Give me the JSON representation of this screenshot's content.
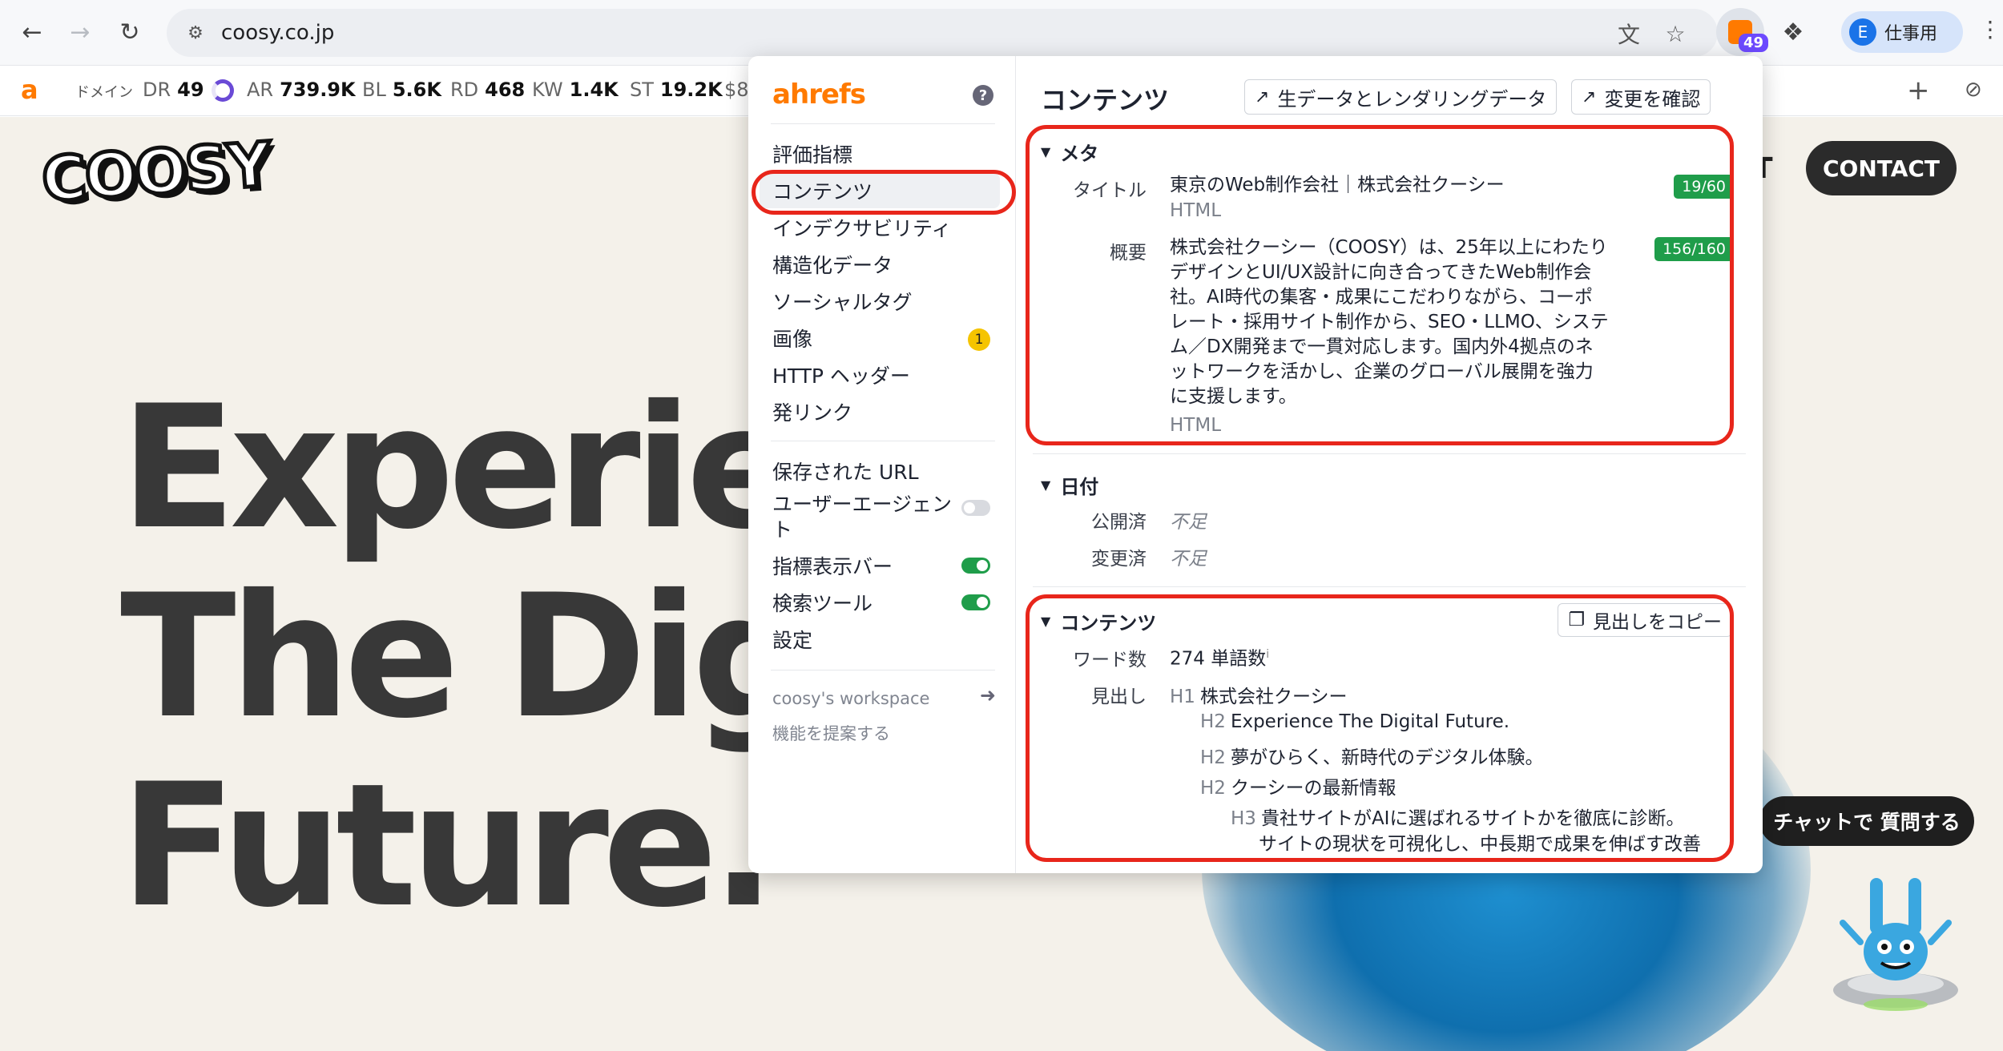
{
  "browser": {
    "url": "coosy.co.jp",
    "back_icon": "arrow-left-icon",
    "forward_icon": "arrow-right-icon",
    "reload_icon": "reload-icon",
    "ahrefs_ext_badge": "49",
    "profile_initial": "E",
    "profile_label": "仕事用"
  },
  "seo_bar": {
    "domain_label": "ドメイン",
    "metrics": [
      {
        "key": "DR",
        "value": "49"
      },
      {
        "key": "AR",
        "value": "739.9K"
      },
      {
        "key": "BL",
        "value": "5.6K"
      },
      {
        "key": "RD",
        "value": "468"
      },
      {
        "key": "KW",
        "value": "1.4K"
      },
      {
        "key": "ST",
        "value": "19.2K"
      },
      {
        "key": "$8",
        "value": ""
      }
    ]
  },
  "site": {
    "logo": "COOSY",
    "hero_lines": [
      "Experien",
      "The Digi",
      "Future."
    ],
    "contact": "CONTACT",
    "nav_fragment": "T",
    "chat": "チャットで 質問する"
  },
  "popup": {
    "logo": "ahrefs",
    "sidebar": {
      "items": [
        {
          "label": "評価指標"
        },
        {
          "label": "コンテンツ"
        },
        {
          "label": "インデクサビリティ"
        },
        {
          "label": "構造化データ"
        },
        {
          "label": "ソーシャルタグ"
        },
        {
          "label": "画像",
          "badge": "1"
        },
        {
          "label": "HTTP ヘッダー"
        },
        {
          "label": "発リンク"
        }
      ],
      "settings": [
        {
          "label": "保存された URL"
        },
        {
          "label": "ユーザーエージェン\nト",
          "label_line1": "ユーザーエージェン",
          "label_line2": "ト",
          "toggle": "off"
        },
        {
          "label": "指標表示バー",
          "toggle": "on"
        },
        {
          "label": "検索ツール",
          "toggle": "on"
        },
        {
          "label": "設定"
        }
      ],
      "workspace": "coosy's workspace",
      "suggest": "機能を提案する"
    },
    "main": {
      "title": "コンテンツ",
      "btn_raw": "生データとレンダリングデータ",
      "btn_changes": "変更を確認",
      "meta": {
        "section": "メタ",
        "title_label": "タイトル",
        "title_value": "東京のWeb制作会社｜株式会社クーシー",
        "title_source": "HTML",
        "title_count": "19/60",
        "desc_label": "概要",
        "desc_lines": [
          "株式会社クーシー（COOSY）は、25年以上にわたり",
          "デザインとUI/UX設計に向き合ってきたWeb制作会",
          "社。AI時代の集客・成果にこだわりながら、コーポ",
          "レート・採用サイト制作から、SEO・LLMO、システ",
          "ム／DX開発まで一貫対応します。国内外4拠点のネ",
          "ットワークを活かし、企業のグローバル展開を強力",
          "に支援します。"
        ],
        "desc_source": "HTML",
        "desc_count": "156/160"
      },
      "dates": {
        "section": "日付",
        "published_label": "公開済",
        "published_value": "不足",
        "modified_label": "変更済",
        "modified_value": "不足"
      },
      "content": {
        "section": "コンテンツ",
        "copy_btn": "見出しをコピー",
        "word_label": "ワード数",
        "word_value": "274 単語数",
        "info": "i",
        "headings_label": "見出し",
        "headings": [
          {
            "tag": "H1",
            "text": "株式会社クーシー"
          },
          {
            "tag": "H2",
            "text": "Experience The Digital Future."
          },
          {
            "tag": "H2",
            "text": "夢がひらく、新時代のデジタル体験。"
          },
          {
            "tag": "H2",
            "text": "クーシーの最新情報"
          },
          {
            "tag": "H3",
            "text": "貴社サイトがAIに選ばれるサイトかを徹底に診断。"
          },
          {
            "tag": "",
            "text": "サイトの現状を可視化し、中長期で成果を伸ばす改善"
          }
        ]
      }
    }
  },
  "colors": {
    "highlight": "#e8261b",
    "ahrefs_orange": "#ff7a00",
    "badge_green": "#1f9d4a"
  }
}
